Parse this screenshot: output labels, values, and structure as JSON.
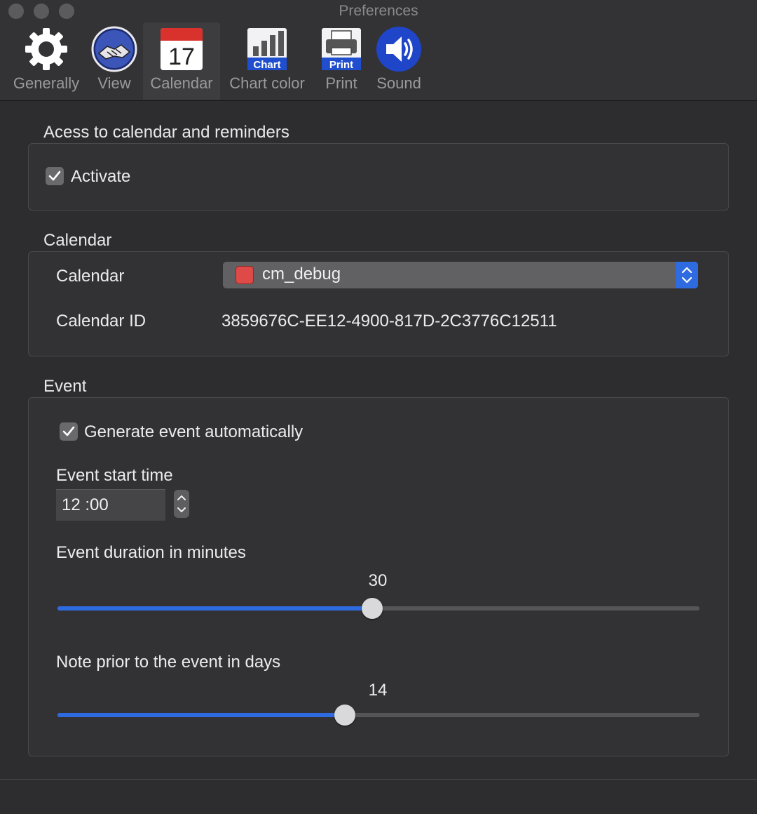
{
  "window": {
    "title": "Preferences"
  },
  "toolbar": {
    "items": [
      {
        "label": "Generally",
        "icon": "gear-icon"
      },
      {
        "label": "View",
        "icon": "handshake-icon"
      },
      {
        "label": "Calendar",
        "icon": "calendar-icon",
        "badge": "17",
        "active": true
      },
      {
        "label": "Chart color",
        "icon": "chart-icon",
        "badge": "Chart"
      },
      {
        "label": "Print",
        "icon": "printer-icon",
        "badge": "Print"
      },
      {
        "label": "Sound",
        "icon": "speaker-icon"
      }
    ]
  },
  "access": {
    "title": "Acess to calendar and reminders",
    "activate_label": "Activate",
    "activate_checked": true
  },
  "calendar": {
    "title": "Calendar",
    "calendar_label": "Calendar",
    "calendar_value": "cm_debug",
    "calendar_color": "#dd4a47",
    "id_label": "Calendar ID",
    "id_value": "3859676C-EE12-4900-817D-2C3776C12511"
  },
  "event": {
    "title": "Event",
    "auto_label": "Generate event automatically",
    "auto_checked": true,
    "start_label": "Event start time",
    "start_value": "12 :00",
    "duration_label": "Event duration in minutes",
    "duration_value": "30",
    "duration_fraction": 0.49,
    "note_label": "Note prior to the event in days",
    "note_value": "14",
    "note_fraction": 0.448
  },
  "colors": {
    "accent": "#2f6be0"
  }
}
